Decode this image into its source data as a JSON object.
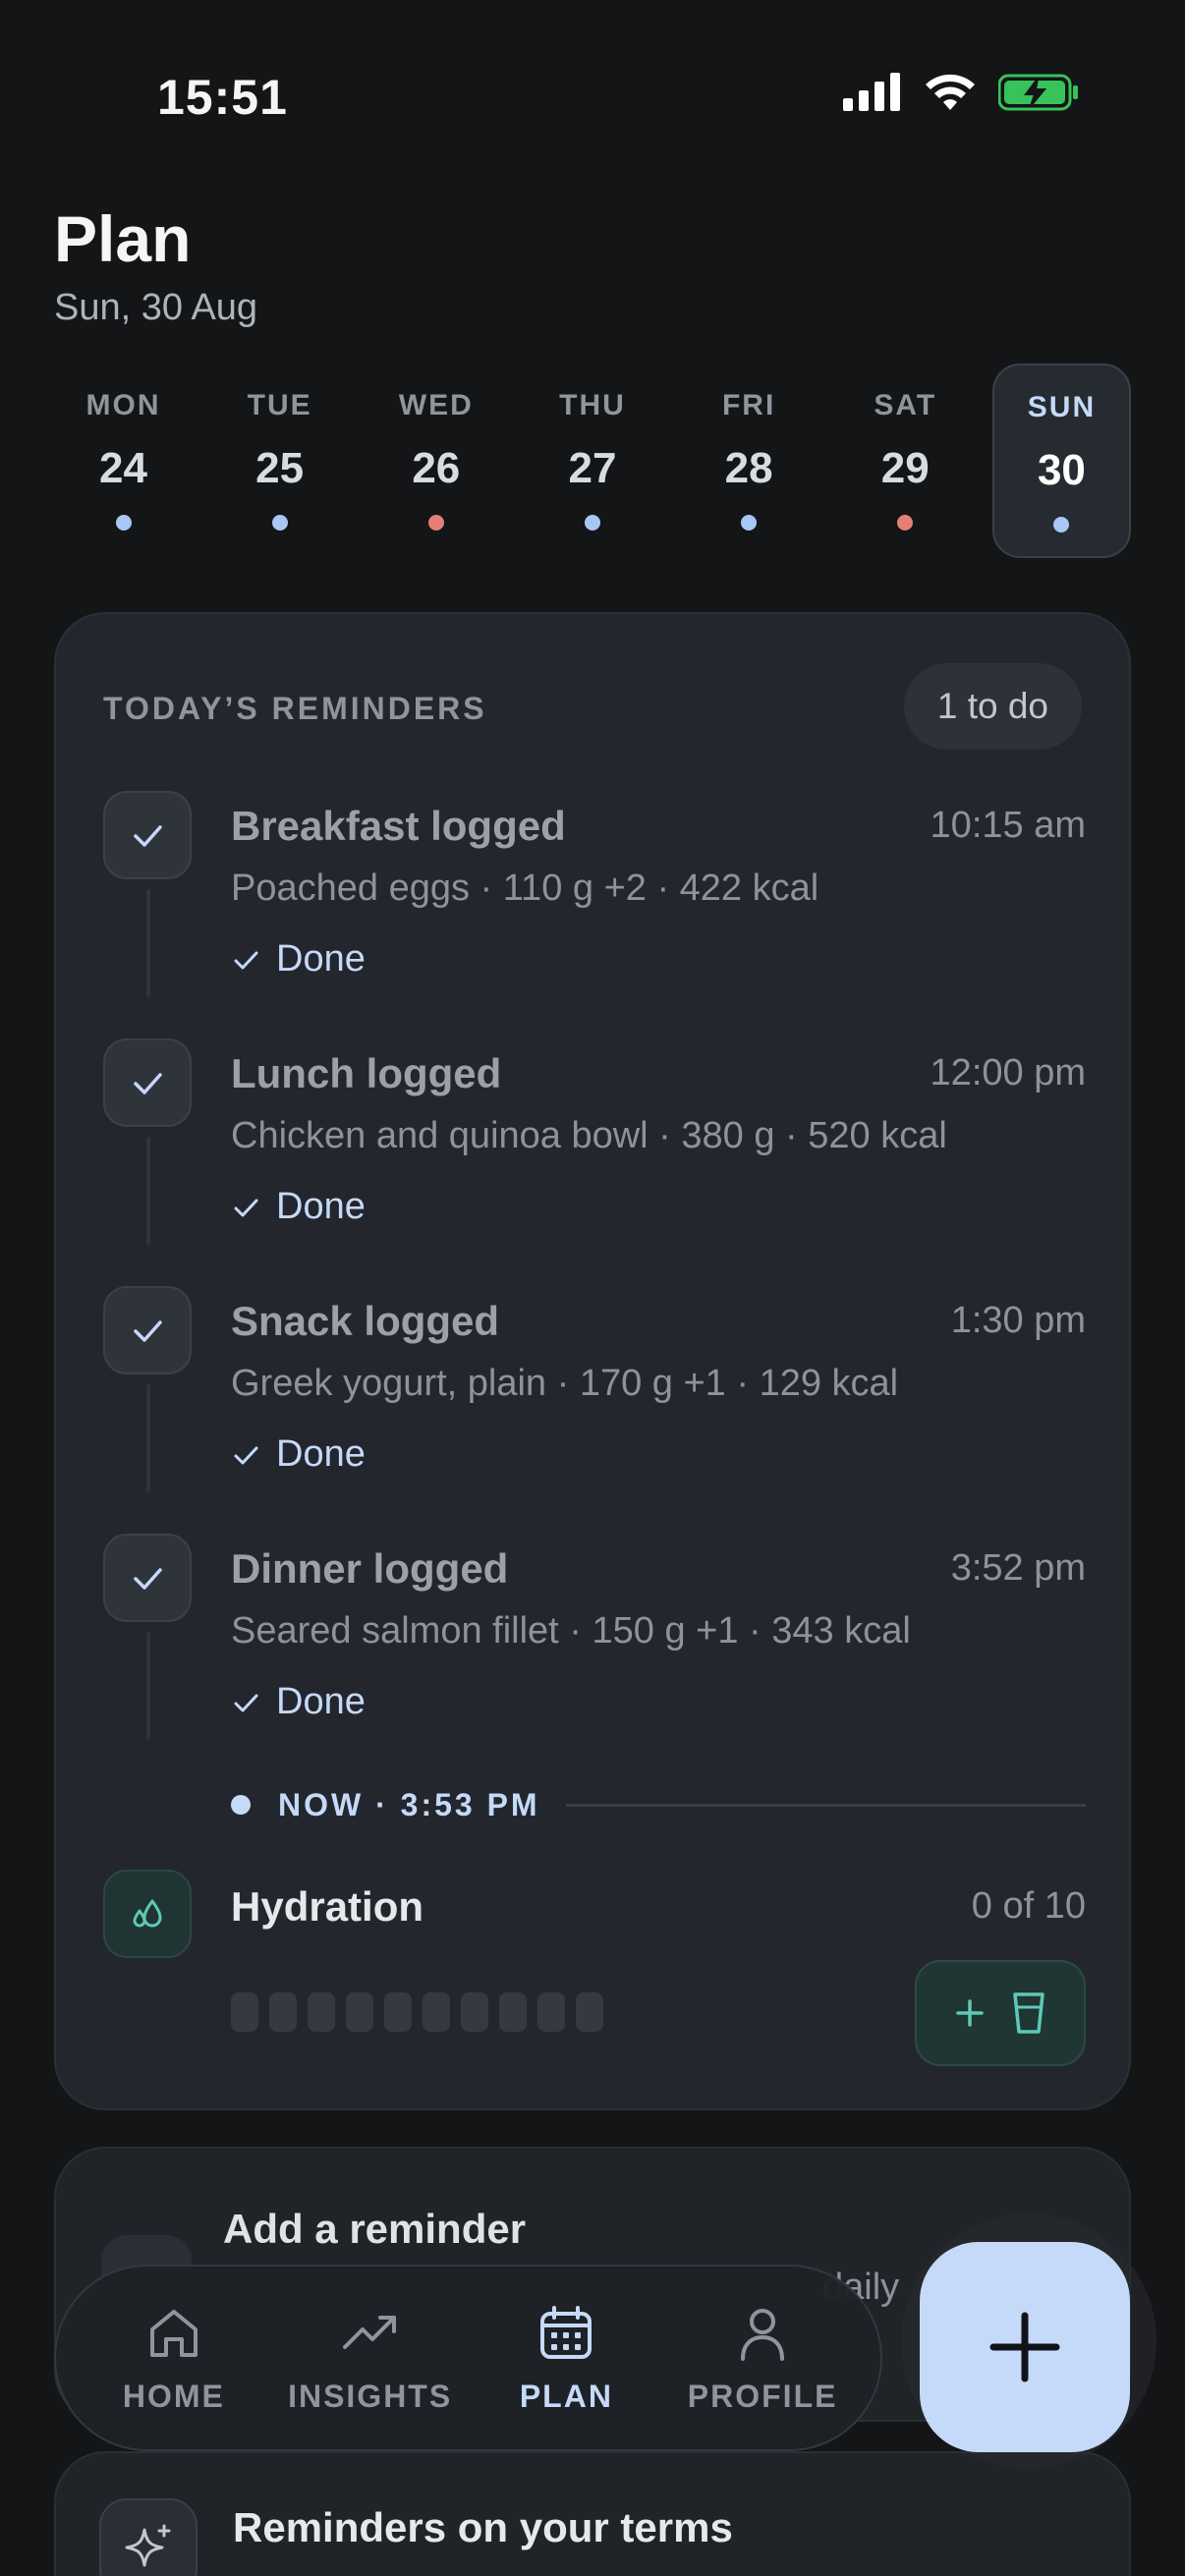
{
  "status": {
    "time": "15:51"
  },
  "header": {
    "title": "Plan",
    "date": "Sun, 30 Aug"
  },
  "week": [
    {
      "name": "MON",
      "num": "24",
      "dot": "#a9c7f5"
    },
    {
      "name": "TUE",
      "num": "25",
      "dot": "#a9c7f5"
    },
    {
      "name": "WED",
      "num": "26",
      "dot": "#e57f76"
    },
    {
      "name": "THU",
      "num": "27",
      "dot": "#a9c7f5"
    },
    {
      "name": "FRI",
      "num": "28",
      "dot": "#a9c7f5"
    },
    {
      "name": "SAT",
      "num": "29",
      "dot": "#e57f76"
    },
    {
      "name": "SUN",
      "num": "30",
      "dot": "#a9c7f5",
      "selected": true
    }
  ],
  "reminders": {
    "title": "TODAY’S REMINDERS",
    "badge": "1 to do",
    "entries": [
      {
        "title": "Breakfast logged",
        "time": "10:15 am",
        "detail": "Poached eggs · 110 g +2 · 422 kcal",
        "status": "Done"
      },
      {
        "title": "Lunch logged",
        "time": "12:00 pm",
        "detail": "Chicken and quinoa bowl · 380 g · 520 kcal",
        "status": "Done"
      },
      {
        "title": "Snack logged",
        "time": "1:30 pm",
        "detail": "Greek yogurt, plain · 170 g +1 · 129 kcal",
        "status": "Done"
      },
      {
        "title": "Dinner logged",
        "time": "3:52 pm",
        "detail": "Seared salmon fillet · 150 g +1 · 343 kcal",
        "status": "Done"
      }
    ],
    "now": "NOW · 3:53 PM",
    "hydration": {
      "title": "Hydration",
      "count": "0 of 10",
      "filled": 0,
      "total": 10
    }
  },
  "add_reminder": {
    "title": "Add a reminder",
    "subtitle_fragment": "daily"
  },
  "terms_card": {
    "title": "Reminders on your terms"
  },
  "nav": {
    "items": [
      {
        "label": "HOME",
        "icon": "home-icon"
      },
      {
        "label": "INSIGHTS",
        "icon": "trend-icon"
      },
      {
        "label": "PLAN",
        "icon": "calendar-icon",
        "active": true
      },
      {
        "label": "PROFILE",
        "icon": "person-icon"
      }
    ]
  },
  "colors": {
    "accent": "#c5d9f8",
    "hydration": "#5fc8b8",
    "background": "#141517"
  }
}
